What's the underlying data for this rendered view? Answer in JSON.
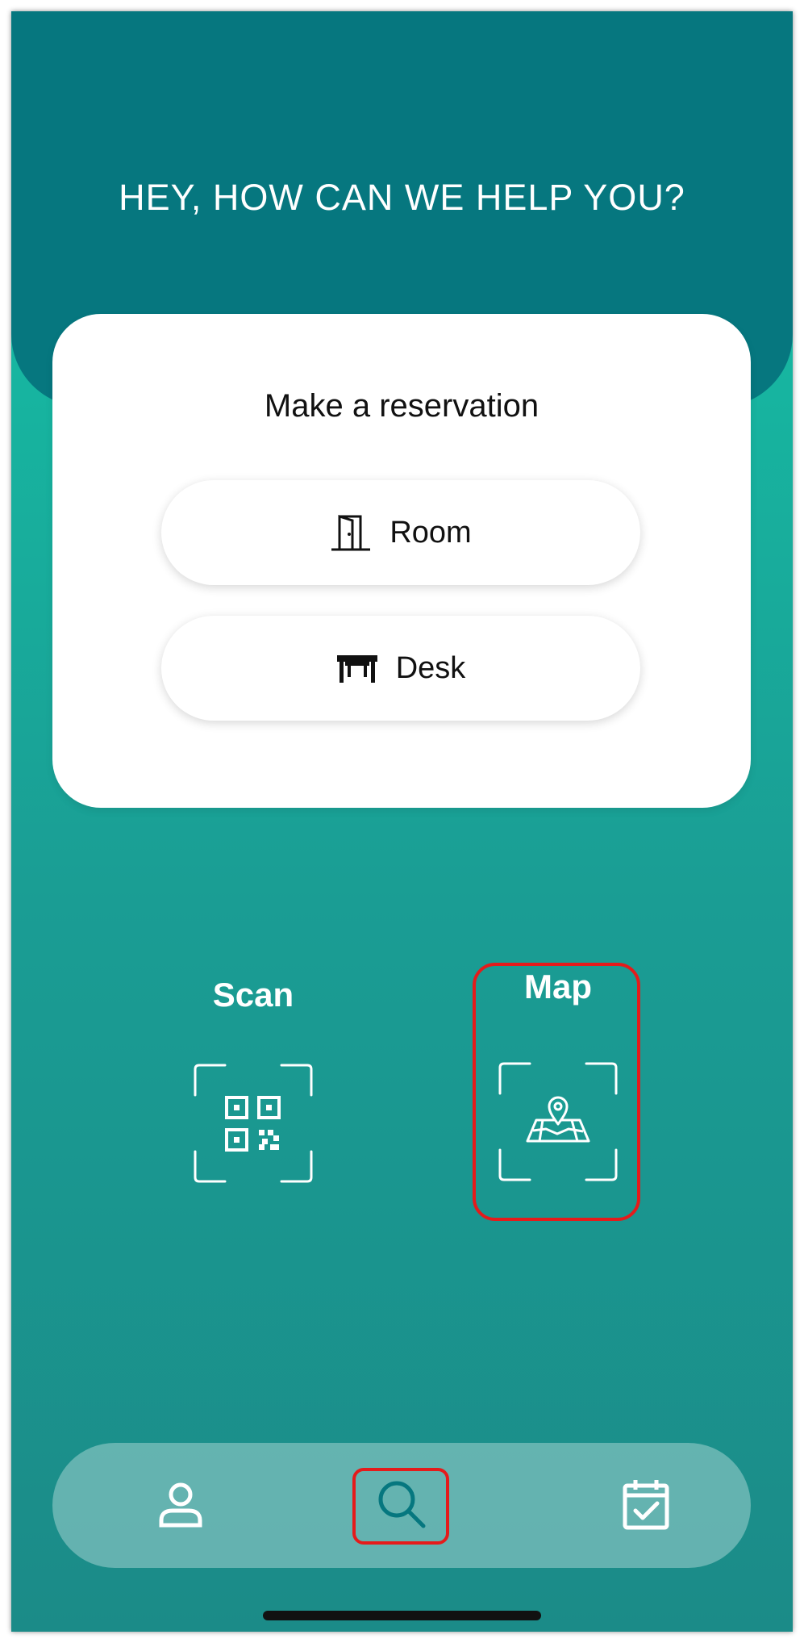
{
  "header": {
    "title": "HEY, HOW CAN WE HELP YOU?"
  },
  "reservation": {
    "title": "Make a reservation",
    "options": [
      {
        "label": "Room",
        "icon": "door-icon"
      },
      {
        "label": "Desk",
        "icon": "desk-icon"
      }
    ]
  },
  "actions": [
    {
      "label": "Scan",
      "icon": "qr-code-icon"
    },
    {
      "label": "Map",
      "icon": "map-pin-icon"
    }
  ],
  "nav": {
    "items": [
      {
        "icon": "profile-icon"
      },
      {
        "icon": "search-icon",
        "active": true
      },
      {
        "icon": "calendar-check-icon"
      }
    ]
  },
  "colors": {
    "header_bg": "#06777f",
    "gradient_top": "#15c4ab",
    "gradient_bottom": "#1b8b88",
    "highlight": "#e41b1b",
    "active_nav_icon": "#06777f"
  }
}
